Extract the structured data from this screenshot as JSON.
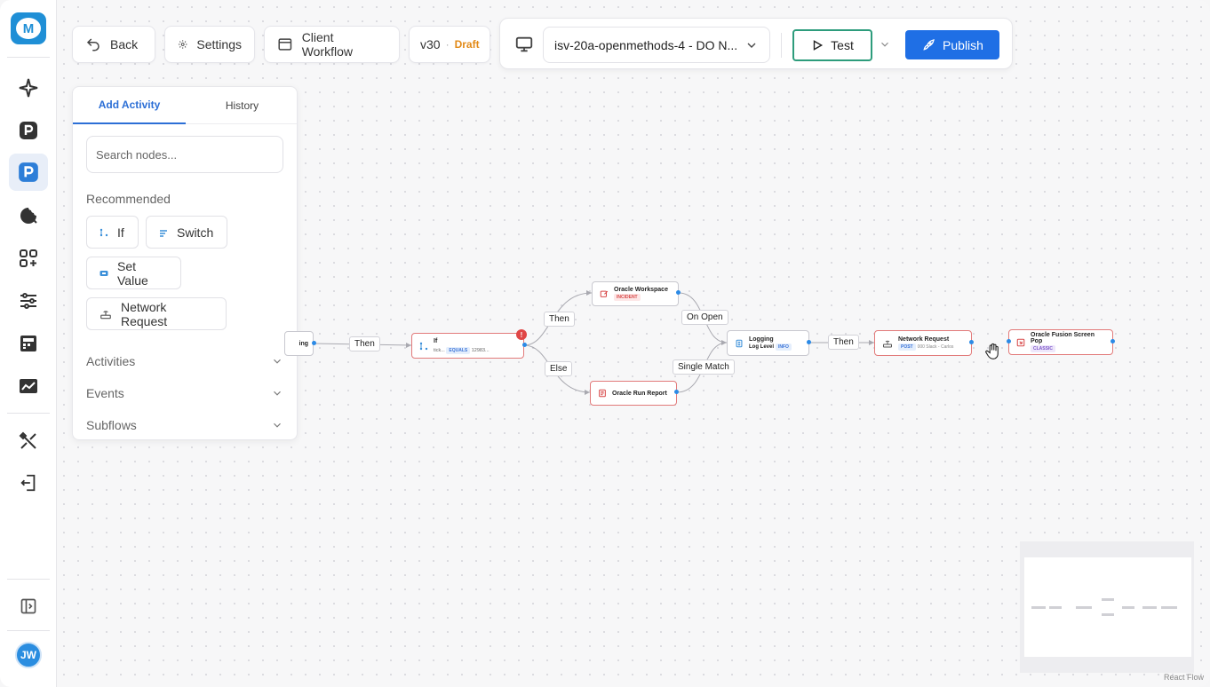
{
  "app": {
    "logo_letter": "M",
    "user_initials": "JW",
    "sidebar_icons": [
      "sparkle-icon",
      "p-logo-icon",
      "p-logo-active-icon",
      "cookie-icon",
      "apps-icon",
      "sliders-icon",
      "dashboard-icon",
      "analytics-icon",
      "tools-icon",
      "logout-icon",
      "panel-toggle-icon"
    ]
  },
  "toolbar": {
    "back_label": "Back",
    "settings_label": "Settings",
    "workflow_label": "Client Workflow",
    "version": "v30",
    "separator": "·",
    "status": "Draft",
    "environment": "isv-20a-openmethods-4 - DO N...",
    "test_label": "Test",
    "publish_label": "Publish"
  },
  "panel": {
    "tabs": [
      "Add Activity",
      "History"
    ],
    "search_placeholder": "Search nodes...",
    "recommended_title": "Recommended",
    "recommended": [
      "If",
      "Switch",
      "Set Value",
      "Network Request"
    ],
    "sections": [
      "Activities",
      "Events",
      "Subflows"
    ]
  },
  "flow": {
    "partial_node_text": "ing",
    "nodes": {
      "if": {
        "title": "If",
        "field": "tick...",
        "operator": "EQUALS",
        "value": "12983...",
        "error_count": "!"
      },
      "oracle_workspace": {
        "title": "Oracle Workspace",
        "badge": "INCIDENT"
      },
      "oracle_run_report": {
        "title": "Oracle Run Report"
      },
      "logging": {
        "title": "Logging",
        "subtitle": "Log Level",
        "badge": "INFO"
      },
      "network_request": {
        "title": "Network Request",
        "badge": "POST",
        "detail": "000 Slack - Carlos"
      },
      "oracle_fusion": {
        "title": "Oracle Fusion Screen Pop",
        "badge": "CLASSIC"
      }
    },
    "edge_labels": {
      "then_1": "Then",
      "then_2": "Then",
      "else": "Else",
      "on_open": "On Open",
      "single_match": "Single Match",
      "then_3": "Then"
    }
  },
  "footer": {
    "attribution": "React Flow"
  },
  "colors": {
    "accent": "#1f6fe5",
    "test_border": "#2d9c7c",
    "draft": "#e28a18",
    "node_error_border": "#e27a7a"
  }
}
